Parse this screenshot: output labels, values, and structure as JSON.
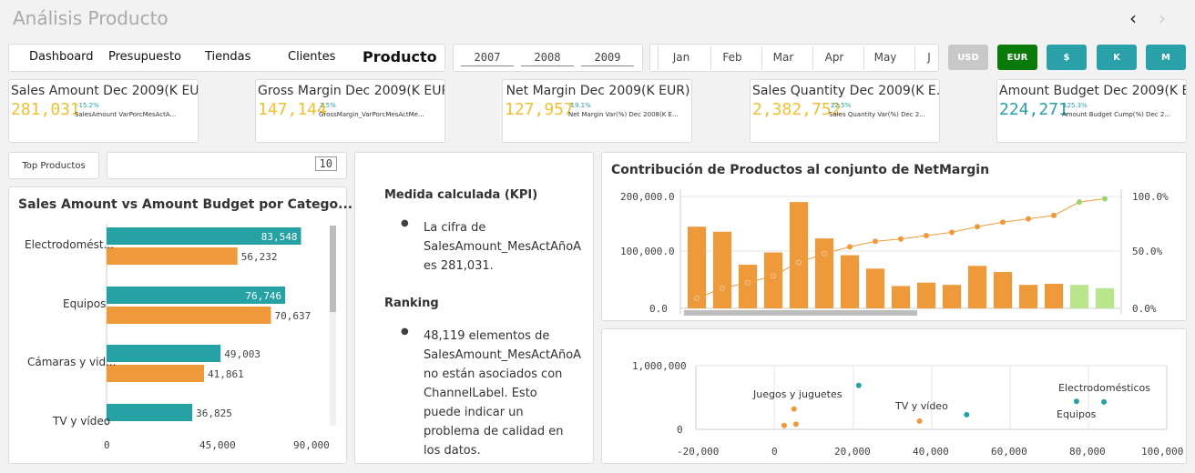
{
  "header": {
    "title": "Análisis Producto"
  },
  "tabs": [
    "Dashboard",
    "Presupuesto",
    "Tiendas",
    "Clientes",
    "Producto"
  ],
  "years": [
    "2007",
    "2008",
    "2009"
  ],
  "months": [
    "Jan",
    "Feb",
    "Mar",
    "Apr",
    "May",
    "J"
  ],
  "currency_buttons": [
    {
      "label": "USD",
      "color": "#c8c8c8"
    },
    {
      "label": "EUR",
      "color": "#0a7a0a"
    },
    {
      "label": "$",
      "color": "#2aa0a8"
    },
    {
      "label": "K",
      "color": "#2aa0a8"
    },
    {
      "label": "M",
      "color": "#2aa0a8"
    }
  ],
  "kpis": [
    {
      "title": "Sales Amount Dec 2009(K EU...",
      "value": "281,031",
      "pct": "-15.2%",
      "sub": "SalesAmount VarPorcMesActA...",
      "color": "#f0c030"
    },
    {
      "title": "Gross Margin Dec 2009(K EUR)",
      "value": "147,144",
      "pct": "2.5%",
      "sub": "GrossMargin_VarPorcMesActMe...",
      "color": "#f0c030"
    },
    {
      "title": "Net Margin Dec 2009(K EUR)",
      "value": "127,957",
      "pct": "-19.1%",
      "sub": "Net Margin Var(%) Dec 2008(K E...",
      "color": "#f0c030"
    },
    {
      "title": "Sales Quantity Dec 2009(K E...",
      "value": "2,382,752",
      "pct": "22.5%",
      "sub": "Sales Quantity Var(%) Dec 2...",
      "color": "#f0c030"
    },
    {
      "title": "Amount Budget Dec 2009(K EUR)",
      "value": "224,271",
      "pct": "125.3%",
      "sub": "Amount Budget Cump(%) Dec 2...",
      "color": "#2aa0a8"
    }
  ],
  "top_products": {
    "label": "Top Productos",
    "value": "10"
  },
  "bar_chart": {
    "title": "Sales Amount vs Amount Budget por Catego...",
    "categories": [
      "Electrodomést...",
      "Equipos",
      "Cámaras y vid...",
      "TV y vídeo"
    ],
    "ticks": [
      "0",
      "45,000",
      "90,000"
    ]
  },
  "info_panel": {
    "heading1": "Medida calculada (KPI)",
    "lines1": [
      "La cifra de",
      "SalesAmount_MesActAñoA",
      "es 281,031."
    ],
    "heading2": "Ranking",
    "lines2": [
      "48,119 elementos de",
      "SalesAmount_MesActAñoA",
      "no están asociados con",
      "ChannelLabel. Esto",
      "puede indicar un",
      "problema de calidad en",
      "los datos."
    ]
  },
  "pareto": {
    "title": "Contribución de Productos al conjunto de NetMargin",
    "left_ticks": [
      "200,000.0",
      "100,000.0",
      "0.0"
    ],
    "right_ticks": [
      "100.0%",
      "50.0%",
      "0.0%"
    ]
  },
  "scatter": {
    "y_ticks": [
      "1,000,000",
      "0"
    ],
    "x_ticks": [
      "-20,000",
      "0",
      "20,000",
      "40,000",
      "60,000",
      "80,000",
      "100,000"
    ],
    "labels": [
      "Juegos y juguetes",
      "TV y vídeo",
      "Electrodomésticos",
      "Equipos"
    ]
  },
  "chart_data": [
    {
      "type": "bar",
      "title": "Sales Amount vs Amount Budget por Catego...",
      "categories": [
        "Electrodomést...",
        "Equipos",
        "Cámaras y vid...",
        "TV y vídeo"
      ],
      "series": [
        {
          "values": [
            83548,
            76746,
            49003,
            36825
          ],
          "color": "#26a2a4"
        },
        {
          "values": [
            56232,
            70637,
            41861,
            null
          ],
          "color": "#ef9a3a"
        }
      ],
      "xlim": [
        0,
        90000
      ],
      "orientation": "horizontal"
    },
    {
      "type": "bar",
      "title": "Contribución de Productos al conjunto de NetMargin",
      "values": [
        146000,
        137000,
        78000,
        100000,
        190000,
        125000,
        95000,
        71000,
        40000,
        46000,
        42000,
        76000,
        65000,
        42000,
        44000,
        42000,
        36000
      ],
      "colors": [
        "#ef9a3a",
        "#ef9a3a",
        "#ef9a3a",
        "#ef9a3a",
        "#ef9a3a",
        "#ef9a3a",
        "#ef9a3a",
        "#ef9a3a",
        "#ef9a3a",
        "#ef9a3a",
        "#ef9a3a",
        "#ef9a3a",
        "#ef9a3a",
        "#ef9a3a",
        "#ef9a3a",
        "#b9e58c",
        "#b9e58c"
      ],
      "cumulative_pct": [
        9,
        18,
        23,
        29,
        41,
        49,
        55,
        60,
        62,
        65,
        68,
        73,
        77,
        80,
        83,
        95,
        98
      ],
      "ylim": [
        0,
        200000
      ],
      "y2lim": [
        0,
        100
      ]
    },
    {
      "type": "scatter",
      "points": [
        {
          "x": 5000,
          "y": 320000,
          "color": "#ef9a3a"
        },
        {
          "x": 2500,
          "y": 60000,
          "color": "#ef9a3a"
        },
        {
          "x": 5500,
          "y": 80000,
          "color": "#ef9a3a"
        },
        {
          "x": 21500,
          "y": 690000,
          "color": "#26a2a4"
        },
        {
          "x": 37000,
          "y": 130000,
          "color": "#ef9a3a"
        },
        {
          "x": 49000,
          "y": 230000,
          "color": "#26a2a4"
        },
        {
          "x": 77000,
          "y": 440000,
          "color": "#26a2a4"
        },
        {
          "x": 84000,
          "y": 430000,
          "color": "#26a2a4"
        }
      ],
      "xlim": [
        -20000,
        100000
      ],
      "ylim": [
        0,
        1000000
      ]
    }
  ]
}
